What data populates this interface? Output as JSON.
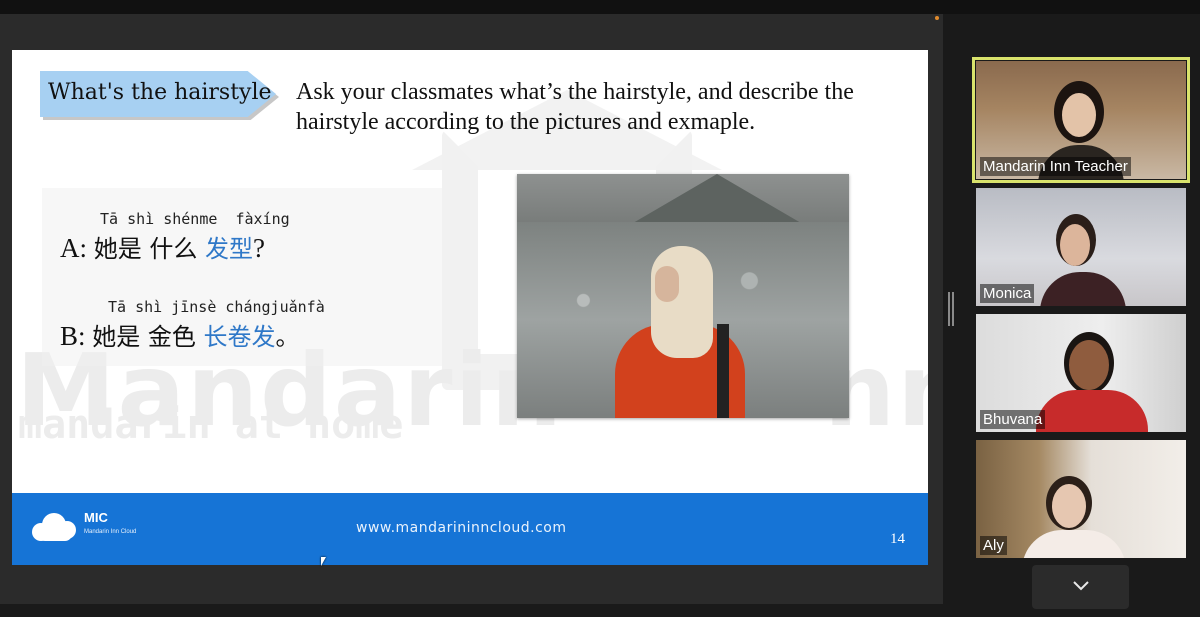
{
  "slide": {
    "tag_label": "What's the hairstyle",
    "instruction": "Ask your classmates what’s the hairstyle, and describe the hairstyle according to the pictures and exmaple.",
    "watermark_title": "Mandarin",
    "watermark_title_right": "nn",
    "watermark_sub": "mandarin at home",
    "line_a": {
      "pinyin": "Tā shì shénme  fàxíng",
      "prefix": "A: ",
      "text": "她是 什么 ",
      "highlight": "发型",
      "suffix": "?"
    },
    "line_b": {
      "pinyin": "Tā shì jīnsè chángjuǎnfà",
      "prefix": "B: ",
      "text": "她是 金色 ",
      "highlight": "长卷发",
      "suffix": "。"
    },
    "footer": {
      "brand": "MIC",
      "brand_sub": "Mandarin Inn Cloud",
      "url": "www.mandarininncloud.com",
      "page_number": "14"
    }
  },
  "participants": [
    {
      "name": "Mandarin Inn Teacher",
      "active": true
    },
    {
      "name": "Monica",
      "active": false
    },
    {
      "name": "Bhuvana",
      "active": false
    },
    {
      "name": "Aly",
      "active": false
    }
  ],
  "icons": {
    "more": "chevron-down-icon"
  },
  "colors": {
    "footer_blue": "#1674d6",
    "highlight_blue": "#2f78c8",
    "tag_blue": "#a7d0f2",
    "active_speaker": "#d9e36c"
  }
}
